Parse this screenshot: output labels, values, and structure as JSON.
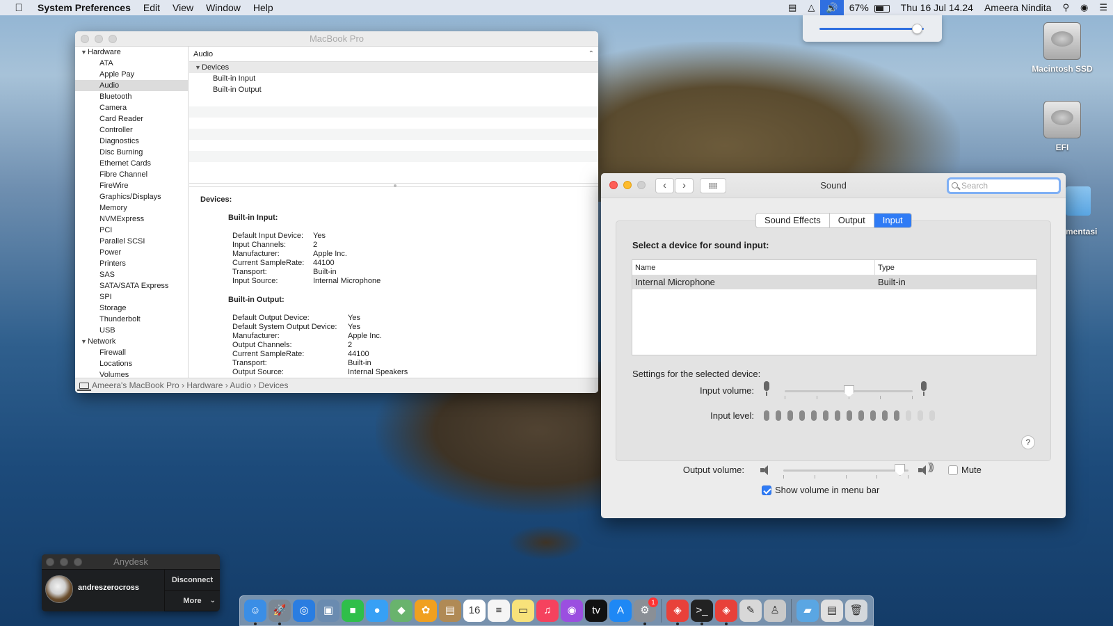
{
  "menubar": {
    "app_name": "System Preferences",
    "menus": [
      "Edit",
      "View",
      "Window",
      "Help"
    ],
    "battery_percent": "67%",
    "datetime": "Thu 16 Jul  14.24",
    "user": "Ameera Nindita"
  },
  "volume_popup": {
    "level": 0.93
  },
  "desktop": {
    "icons": [
      "Macintosh SSD",
      "EFI"
    ],
    "partial_label": "mentasi"
  },
  "sysinfo": {
    "title": "MacBook Pro",
    "sidebar": {
      "hardware_group": "Hardware",
      "hardware_items": [
        "ATA",
        "Apple Pay",
        "Audio",
        "Bluetooth",
        "Camera",
        "Card Reader",
        "Controller",
        "Diagnostics",
        "Disc Burning",
        "Ethernet Cards",
        "Fibre Channel",
        "FireWire",
        "Graphics/Displays",
        "Memory",
        "NVMExpress",
        "PCI",
        "Parallel SCSI",
        "Power",
        "Printers",
        "SAS",
        "SATA/SATA Express",
        "SPI",
        "Storage",
        "Thunderbolt",
        "USB"
      ],
      "selected": "Audio",
      "network_group": "Network",
      "network_items": [
        "Firewall",
        "Locations",
        "Volumes"
      ]
    },
    "main_header": "Audio",
    "tree": {
      "group": "Devices",
      "items": [
        "Built-in Input",
        "Built-in Output"
      ]
    },
    "detail": {
      "heading": "Devices:",
      "input_title": "Built-in Input:",
      "input_rows": [
        [
          "Default Input Device:",
          "Yes"
        ],
        [
          "Input Channels:",
          "2"
        ],
        [
          "Manufacturer:",
          "Apple Inc."
        ],
        [
          "Current SampleRate:",
          "44100"
        ],
        [
          "Transport:",
          "Built-in"
        ],
        [
          "Input Source:",
          "Internal Microphone"
        ]
      ],
      "output_title": "Built-in Output:",
      "output_rows": [
        [
          "Default Output Device:",
          "Yes"
        ],
        [
          "Default System Output Device:",
          "Yes"
        ],
        [
          "Manufacturer:",
          "Apple Inc."
        ],
        [
          "Output Channels:",
          "2"
        ],
        [
          "Current SampleRate:",
          "44100"
        ],
        [
          "Transport:",
          "Built-in"
        ],
        [
          "Output Source:",
          "Internal Speakers"
        ]
      ]
    },
    "breadcrumb": [
      "Ameera's MacBook Pro",
      "Hardware",
      "Audio",
      "Devices"
    ]
  },
  "sound": {
    "title": "Sound",
    "search_placeholder": "Search",
    "tabs": [
      "Sound Effects",
      "Output",
      "Input"
    ],
    "active_tab": "Input",
    "select_label": "Select a device for sound input:",
    "table": {
      "headers": [
        "Name",
        "Type"
      ],
      "rows": [
        [
          "Internal Microphone",
          "Built-in"
        ]
      ]
    },
    "settings_label": "Settings for the selected device:",
    "input_volume_label": "Input volume:",
    "input_volume": 0.5,
    "input_level_label": "Input level:",
    "input_level_lit": 12,
    "input_level_total": 15,
    "output_volume_label": "Output volume:",
    "output_volume": 0.93,
    "mute_label": "Mute",
    "mute_checked": false,
    "show_volume_label": "Show volume in menu bar",
    "show_volume_checked": true,
    "help": "?"
  },
  "anydesk": {
    "title": "Anydesk",
    "user": "andreszerocross",
    "disconnect": "Disconnect",
    "more": "More"
  },
  "dock": {
    "apps": [
      {
        "name": "finder",
        "color": "#3a8ee6",
        "glyph": "☺"
      },
      {
        "name": "launchpad",
        "color": "#7a8794",
        "glyph": "🚀"
      },
      {
        "name": "safari",
        "color": "#2a7de1",
        "glyph": "◎"
      },
      {
        "name": "preview",
        "color": "#6a8bb0",
        "glyph": "▣"
      },
      {
        "name": "facetime",
        "color": "#2fbf4a",
        "glyph": "■"
      },
      {
        "name": "messages",
        "color": "#37a0f5",
        "glyph": "●"
      },
      {
        "name": "maps",
        "color": "#69b36d",
        "glyph": "◆"
      },
      {
        "name": "photos",
        "color": "#f0a020",
        "glyph": "✿"
      },
      {
        "name": "notefile",
        "color": "#b08a55",
        "glyph": "▤"
      },
      {
        "name": "calendar",
        "color": "#ffffff",
        "glyph": "16"
      },
      {
        "name": "reminders",
        "color": "#f5f5f5",
        "glyph": "≡"
      },
      {
        "name": "notes",
        "color": "#f8e27a",
        "glyph": "▭"
      },
      {
        "name": "music",
        "color": "#f5425e",
        "glyph": "♫"
      },
      {
        "name": "podcasts",
        "color": "#9b4fe0",
        "glyph": "◉"
      },
      {
        "name": "apple-tv",
        "color": "#111111",
        "glyph": "tv"
      },
      {
        "name": "app-store",
        "color": "#1e88f5",
        "glyph": "A"
      },
      {
        "name": "system-preferences",
        "color": "#8a8f96",
        "glyph": "⚙",
        "badge": "1"
      },
      {
        "name": "anydesk",
        "color": "#e8413a",
        "glyph": "◈"
      },
      {
        "name": "terminal",
        "color": "#222222",
        "glyph": ">_"
      },
      {
        "name": "anydesk-connection",
        "color": "#e8413a",
        "glyph": "◈"
      },
      {
        "name": "pages",
        "color": "#d8d8d8",
        "glyph": "✎"
      },
      {
        "name": "automator",
        "color": "#c9c9c9",
        "glyph": "♙"
      },
      {
        "name": "downloads-folder",
        "color": "#5aa6e3",
        "glyph": "▰"
      },
      {
        "name": "screenshot-thumbnail",
        "color": "#e0e0e0",
        "glyph": "▤"
      },
      {
        "name": "trash",
        "color": "#d4d8dc",
        "glyph": "🗑"
      }
    ]
  }
}
